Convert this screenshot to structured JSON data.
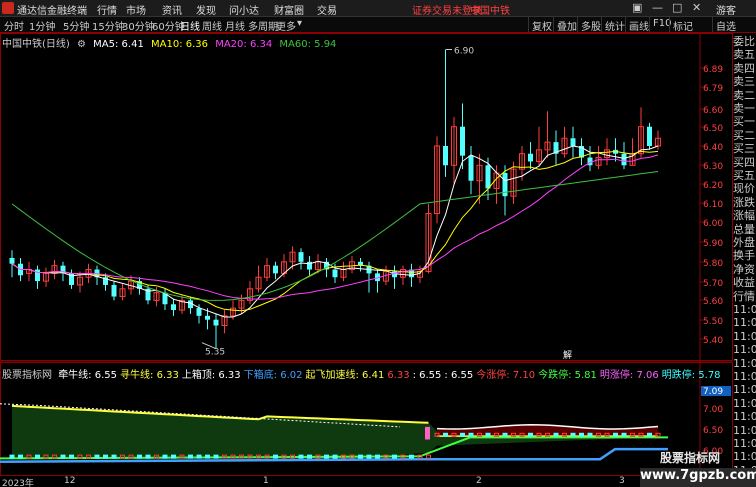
{
  "menubar": {
    "app_title": "通达信金融终端",
    "items": [
      "行情",
      "市场",
      "资讯",
      "发现",
      "问小达",
      "财富圈",
      "交易"
    ],
    "login_notice": "证券交易未登录",
    "stock_name": "中国中铁",
    "user": "游客"
  },
  "toolbar": {
    "periods": [
      "分时",
      "1分钟",
      "5分钟",
      "15分钟",
      "30分钟",
      "60分钟",
      "日线",
      "周线",
      "月线",
      "多周期",
      "更多"
    ],
    "active_period": "日线",
    "buttons": [
      "复权",
      "叠加",
      "多股",
      "统计",
      "画线",
      "F10",
      "标记",
      "自选"
    ]
  },
  "price_info": {
    "title": "中国中铁(日线)",
    "ma5": "MA5: 6.41",
    "ma10": "MA10: 6.36",
    "ma20": "MA20: 6.34",
    "ma60": "MA60: 5.94"
  },
  "price_axis": [
    "6.89",
    "6.79",
    "6.60",
    "6.50",
    "6.40",
    "6.30",
    "6.20",
    "6.10",
    "6.00",
    "5.90",
    "5.80",
    "5.70",
    "5.60",
    "5.50",
    "5.40"
  ],
  "annotations": {
    "high": "6.90",
    "low": "5.35",
    "marker": "解"
  },
  "indicator_info": {
    "name": "股票指标网",
    "items": [
      {
        "label": "牵牛线: 6.55",
        "color": "#ffffff"
      },
      {
        "label": "寻牛线: 6.33",
        "color": "#ffff40"
      },
      {
        "label": "上箱顶: 6.33",
        "color": "#ffffff"
      },
      {
        "label": "下箱底: 6.02",
        "color": "#40a0ff"
      },
      {
        "label": "起飞加速线: 6.41",
        "color": "#ffff40"
      },
      {
        "label": "6.33",
        "color": "#ff4040"
      },
      {
        "label": ": 6.55",
        "color": "#ffffff"
      },
      {
        "label": ": 6.55",
        "color": "#ffffff"
      },
      {
        "label": "今涨停: 7.10",
        "color": "#ff4040"
      },
      {
        "label": "今跌停: 5.81",
        "color": "#40ff40"
      },
      {
        "label": "明涨停: 7.06",
        "color": "#ff60ff"
      },
      {
        "label": "明跌停: 5.78",
        "color": "#40ffff"
      }
    ]
  },
  "sub_axis": [
    "7.09",
    "7.00",
    "6.50",
    "6.00"
  ],
  "sidebar_quote": [
    "委比",
    "卖五",
    "卖四",
    "卖三",
    "卖二",
    "卖一",
    "买一",
    "买二",
    "买三",
    "买四",
    "买五",
    "现价",
    "涨跌",
    "涨幅",
    "总量",
    "外盘",
    "换手",
    "净资",
    "收益",
    "行情",
    "11:0",
    "11:0",
    "11:0",
    "11:0",
    "11:0",
    "11:0",
    "11:0",
    "11:0",
    "11:0",
    "11:0",
    "11:0",
    "11:0",
    "11:0"
  ],
  "dates": [
    "2023年",
    "12",
    "1",
    "2",
    "3"
  ],
  "watermark": {
    "big": "股票指标网",
    "url": "www.7gpzb.com"
  },
  "colors": {
    "up": "#ff3c3c",
    "down": "#54ffff",
    "ma5": "#ffffff",
    "ma10": "#ffff00",
    "ma20": "#ff40ff",
    "ma60": "#40c040"
  }
}
